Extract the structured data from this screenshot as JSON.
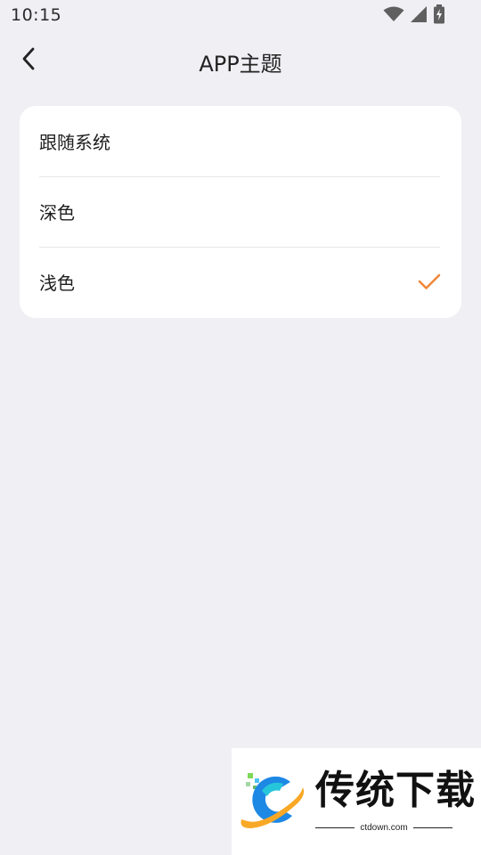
{
  "status_bar": {
    "time": "10:15",
    "icons": [
      "wifi-icon",
      "cell-signal-icon",
      "battery-charging-icon"
    ]
  },
  "header": {
    "title": "APP主题",
    "back_icon": "chevron-left-icon"
  },
  "theme_options": [
    {
      "label": "跟随系统",
      "selected": false
    },
    {
      "label": "深色",
      "selected": false
    },
    {
      "label": "浅色",
      "selected": true
    }
  ],
  "colors": {
    "background": "#f0eff4",
    "card": "#ffffff",
    "accent": "#f0883a"
  },
  "watermark": {
    "title": "传统下载",
    "domain": "ctdown.com"
  }
}
